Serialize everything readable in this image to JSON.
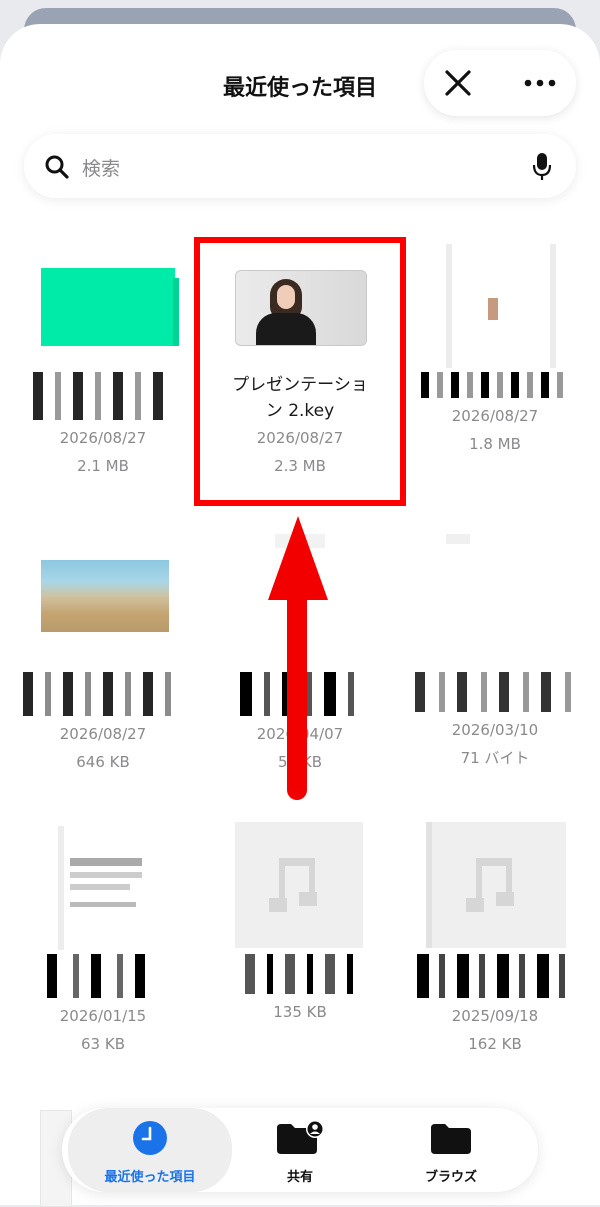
{
  "header": {
    "title": "最近使った項目"
  },
  "search": {
    "placeholder": "検索"
  },
  "files": [
    {
      "name_redacted": true,
      "date": "2026/08/27",
      "size": "2.1 MB"
    },
    {
      "name": "プレゼンテーション 2.key",
      "name_line1": "プレゼンテーショ",
      "name_line2": "ン 2.key",
      "date": "2026/08/27",
      "size": "2.3 MB"
    },
    {
      "name_redacted": true,
      "date": "2026/08/27",
      "size": "1.8 MB"
    },
    {
      "name_redacted": true,
      "date": "2026/08/27",
      "size": "646 KB"
    },
    {
      "name_redacted": true,
      "date": "2026/04/07",
      "size": "53 KB"
    },
    {
      "name_redacted": true,
      "date": "2026/03/10",
      "size": "71 バイト"
    },
    {
      "name_redacted": true,
      "date": "2026/01/15",
      "size": "63 KB"
    },
    {
      "name_redacted": true,
      "date": "",
      "size": "135 KB"
    },
    {
      "name_redacted": true,
      "date": "2025/09/18",
      "size": "162 KB"
    }
  ],
  "tabs": [
    {
      "label": "最近使った項目",
      "icon": "clock-icon",
      "active": true
    },
    {
      "label": "共有",
      "icon": "shared-folder-icon",
      "active": false
    },
    {
      "label": "ブラウズ",
      "icon": "folder-icon",
      "active": false
    }
  ],
  "colors": {
    "accent": "#1a73e8",
    "highlight": "#ff0000"
  }
}
